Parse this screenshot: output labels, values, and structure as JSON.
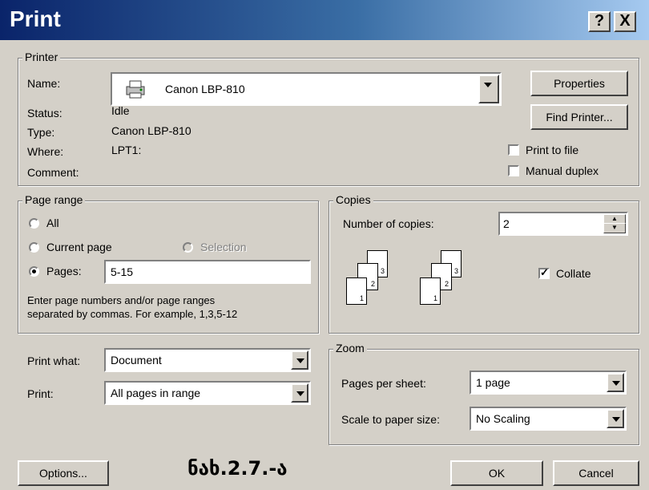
{
  "window": {
    "title": "Print",
    "help_button": "?",
    "close_button": "X"
  },
  "printer": {
    "legend": "Printer",
    "name_label": "Name:",
    "name_value": "Canon LBP-810",
    "status_label": "Status:",
    "status_value": "Idle",
    "type_label": "Type:",
    "type_value": "Canon LBP-810",
    "where_label": "Where:",
    "where_value": "LPT1:",
    "comment_label": "Comment:",
    "properties_button": "Properties",
    "find_printer_button": "Find Printer...",
    "print_to_file_label": "Print to file",
    "manual_duplex_label": "Manual duplex"
  },
  "page_range": {
    "legend": "Page range",
    "all_label": "All",
    "current_page_label": "Current page",
    "selection_label": "Selection",
    "pages_label": "Pages:",
    "pages_value": "5-15",
    "hint_line1": "Enter page numbers and/or page ranges",
    "hint_line2": "separated by commas.  For example, 1,3,5-12"
  },
  "copies": {
    "legend": "Copies",
    "number_label": "Number of copies:",
    "number_value": "2",
    "collate_label": "Collate",
    "page_numbers": [
      "1",
      "2",
      "3"
    ]
  },
  "print_what": {
    "label": "Print what:",
    "value": "Document"
  },
  "print_option": {
    "label": "Print:",
    "value": "All pages in range"
  },
  "zoom": {
    "legend": "Zoom",
    "pages_per_sheet_label": "Pages per sheet:",
    "pages_per_sheet_value": "1 page",
    "scale_label": "Scale to paper size:",
    "scale_value": "No Scaling"
  },
  "footer": {
    "options_button": "Options...",
    "caption": "ნახ.2.7.-ა",
    "ok_button": "OK",
    "cancel_button": "Cancel"
  }
}
